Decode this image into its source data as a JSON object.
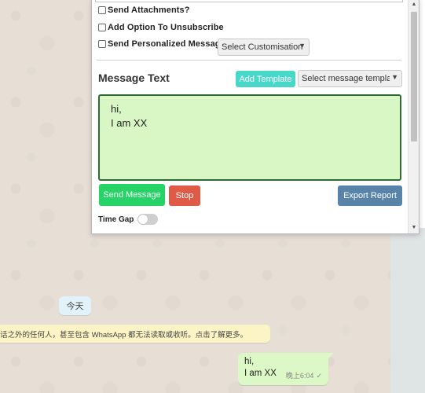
{
  "panel": {
    "options": {
      "send_attachments": "Send Attachments?",
      "add_unsubscribe": "Add Option To Unsubscribe",
      "send_personalized": "Send Personalized Message"
    },
    "customisation_select": "Select Customisation",
    "message_text_title": "Message Text",
    "add_template_label": "Add Template",
    "template_select": "Select message template",
    "message_value": "hi,\nI am XX",
    "send_message_label": "Send Message",
    "stop_label": "Stop",
    "export_report_label": "Export Report",
    "time_gap_label": "Time Gap",
    "time_gap_enabled": false
  },
  "chat": {
    "date_chip": "今天",
    "encryption_notice": "话之外的任何人，甚至包含 WhatsApp 都无法读取或收听。点击了解更多。",
    "message_text": "hi,\nI am XX",
    "message_time": "晚上6:04",
    "message_status_icon": "single-check-icon"
  },
  "colors": {
    "send_button": "#25d366",
    "stop_button": "#e05b47",
    "add_template_button": "#48d8c9",
    "export_button": "#5784a8",
    "textarea_bg": "#d9f7c5",
    "bubble_bg": "#dcf8c6",
    "notice_bg": "#fdf4c5",
    "date_chip_bg": "#e1f2fa"
  }
}
